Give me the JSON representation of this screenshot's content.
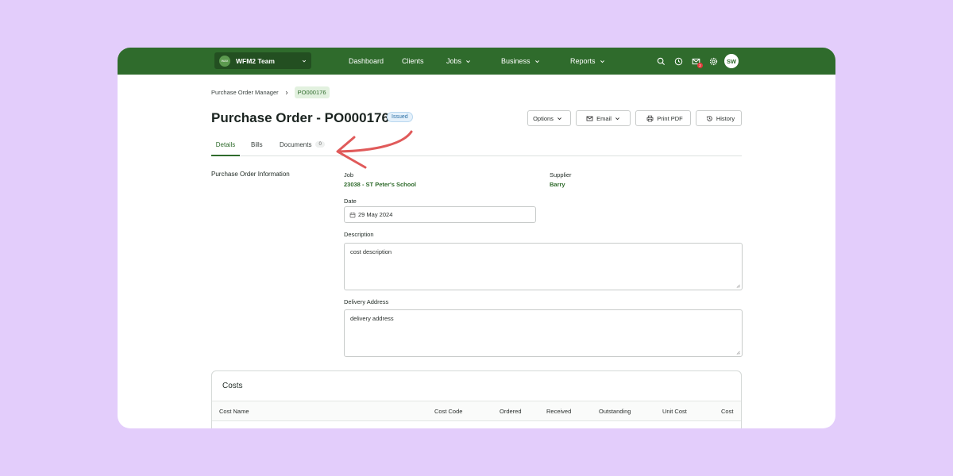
{
  "header": {
    "team_logo_text": "WAX",
    "team_name": "WFM2 Team",
    "nav": [
      {
        "label": "Dashboard"
      },
      {
        "label": "Clients"
      },
      {
        "label": "Jobs"
      },
      {
        "label": "Business"
      },
      {
        "label": "Reports"
      }
    ],
    "notification_count": "2",
    "avatar_initials": "SW"
  },
  "breadcrumb": {
    "parent": "Purchase Order Manager",
    "current": "PO000176"
  },
  "page": {
    "title": "Purchase Order - PO000176",
    "status": "Issued"
  },
  "actions": {
    "options": "Options",
    "email": "Email",
    "print_pdf": "Print PDF",
    "history": "History"
  },
  "tabs": [
    {
      "label": "Details",
      "active": true
    },
    {
      "label": "Bills"
    },
    {
      "label": "Documents",
      "count": "0"
    }
  ],
  "form": {
    "section_title": "Purchase Order Information",
    "job_label": "Job",
    "job_value": "23038 - ST Peter's School",
    "supplier_label": "Supplier",
    "supplier_value": "Barry",
    "date_label": "Date",
    "date_value": "29 May 2024",
    "description_label": "Description",
    "description_value": "cost description",
    "delivery_label": "Delivery Address",
    "delivery_value": "delivery address"
  },
  "costs": {
    "title": "Costs",
    "columns": [
      "Cost Name",
      "Cost Code",
      "Ordered",
      "Received",
      "Outstanding",
      "Unit Cost",
      "Cost"
    ]
  },
  "colors": {
    "brand_green": "#2f6b2c",
    "background": "#e3cdfb",
    "annotation_arrow": "#e05a5a"
  }
}
